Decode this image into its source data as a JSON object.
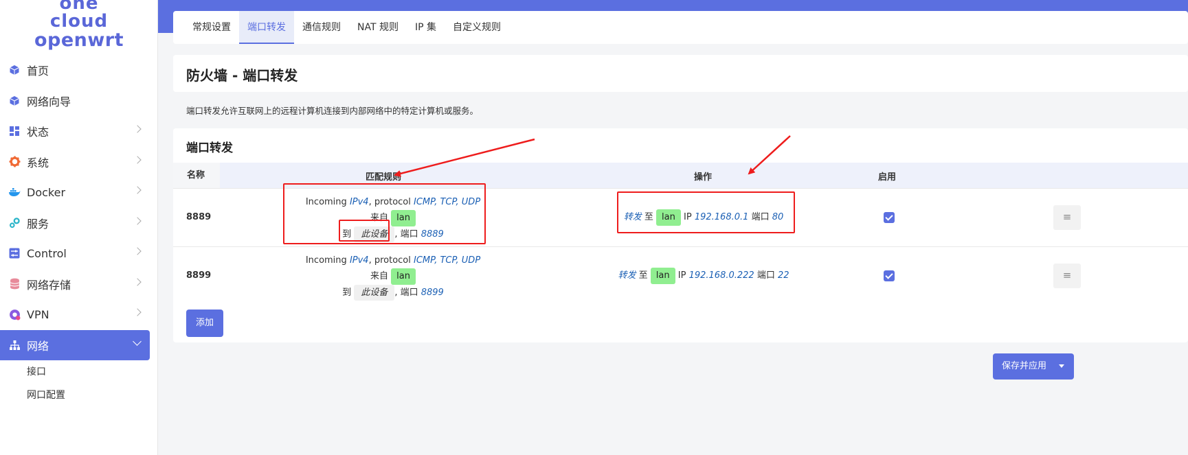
{
  "logo": {
    "line1": "one cloud",
    "line2": "openwrt"
  },
  "sidebar": {
    "items": [
      {
        "label": "首页",
        "icon": "cube-icon",
        "color": "#5b6fe0",
        "has_chevron": false
      },
      {
        "label": "网络向导",
        "icon": "cube-icon",
        "color": "#5b6fe0",
        "has_chevron": false
      },
      {
        "label": "状态",
        "icon": "dashboard-icon",
        "color": "#5b6fe0",
        "has_chevron": true
      },
      {
        "label": "系统",
        "icon": "gear-icon",
        "color": "#f06a35",
        "has_chevron": true
      },
      {
        "label": "Docker",
        "icon": "docker-icon",
        "color": "#2496ed",
        "has_chevron": true
      },
      {
        "label": "服务",
        "icon": "cogs-icon",
        "color": "#2bb5c9",
        "has_chevron": true
      },
      {
        "label": "Control",
        "icon": "sliders-icon",
        "color": "#5b6fe0",
        "has_chevron": true
      },
      {
        "label": "网络存储",
        "icon": "database-icon",
        "color": "#e88a9a",
        "has_chevron": true
      },
      {
        "label": "VPN",
        "icon": "vpn-icon",
        "color": "#8a5be0",
        "has_chevron": true
      },
      {
        "label": "网络",
        "icon": "sitemap-icon",
        "color": "#ffffff",
        "has_chevron": true,
        "active": true
      }
    ],
    "sub_items": [
      "接口",
      "网口配置"
    ]
  },
  "tabs": [
    "常规设置",
    "端口转发",
    "通信规则",
    "NAT 规则",
    "IP 集",
    "自定义规则"
  ],
  "active_tab": "端口转发",
  "page_title": "防火墙 - 端口转发",
  "description": "端口转发允许互联网上的远程计算机连接到内部网络中的特定计算机或服务。",
  "section_title": "端口转发",
  "table": {
    "headers": {
      "name": "名称",
      "match": "匹配规则",
      "action": "操作",
      "enabled": "启用"
    },
    "rows": [
      {
        "name": "8889",
        "incoming": "Incoming",
        "family": "IPv4",
        "protocol_label": ", protocol",
        "protocols": "ICMP, TCP, UDP",
        "from_label": "来自",
        "from_zone": "lan",
        "to_label": "到",
        "to_target": "此设备",
        "port_label": ", 端口",
        "port": "8889",
        "action_verb": "转发",
        "action_to": "至",
        "action_zone": "lan",
        "ip_label": "IP",
        "ip": "192.168.0.1",
        "action_port_label": "端口",
        "action_port": "80",
        "enabled": true
      },
      {
        "name": "8899",
        "incoming": "Incoming",
        "family": "IPv4",
        "protocol_label": ", protocol",
        "protocols": "ICMP, TCP, UDP",
        "from_label": "来自",
        "from_zone": "lan",
        "to_label": "到",
        "to_target": "此设备",
        "port_label": ", 端口",
        "port": "8899",
        "action_verb": "转发",
        "action_to": "至",
        "action_zone": "lan",
        "ip_label": "IP",
        "ip": "192.168.0.222",
        "action_port_label": "端口",
        "action_port": "22",
        "enabled": true
      }
    ],
    "handle_glyph": "≡"
  },
  "buttons": {
    "add": "添加",
    "save_apply": "保存并应用"
  },
  "colors": {
    "accent": "#5b6fe0",
    "zone_badge": "#90ee90",
    "annotation": "#ee1c1c"
  }
}
